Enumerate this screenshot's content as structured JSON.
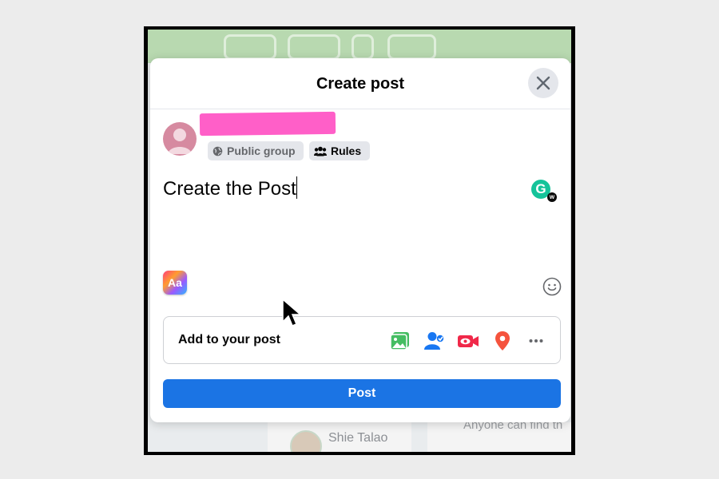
{
  "modal": {
    "title": "Create post",
    "close_icon": "close-icon"
  },
  "author": {
    "privacy_label": "Public group",
    "rules_label": "Rules"
  },
  "composer": {
    "text": "Create the Post",
    "grammarly_letter": "G",
    "grammarly_badge": "w",
    "format_button": "Aa"
  },
  "add_to_post": {
    "label": "Add to your post",
    "icons": [
      "photo-video-icon",
      "tag-people-icon",
      "live-video-icon",
      "location-icon",
      "more-icon"
    ]
  },
  "post_button": "Post",
  "background": {
    "name": "Shie Talao",
    "info": "Anyone can find th"
  },
  "colors": {
    "accent": "#1b74e4",
    "photo": "#45bd62",
    "tag": "#1877f2",
    "live": "#f02849",
    "location": "#f5533d",
    "redaction": "#ff5fc8"
  }
}
